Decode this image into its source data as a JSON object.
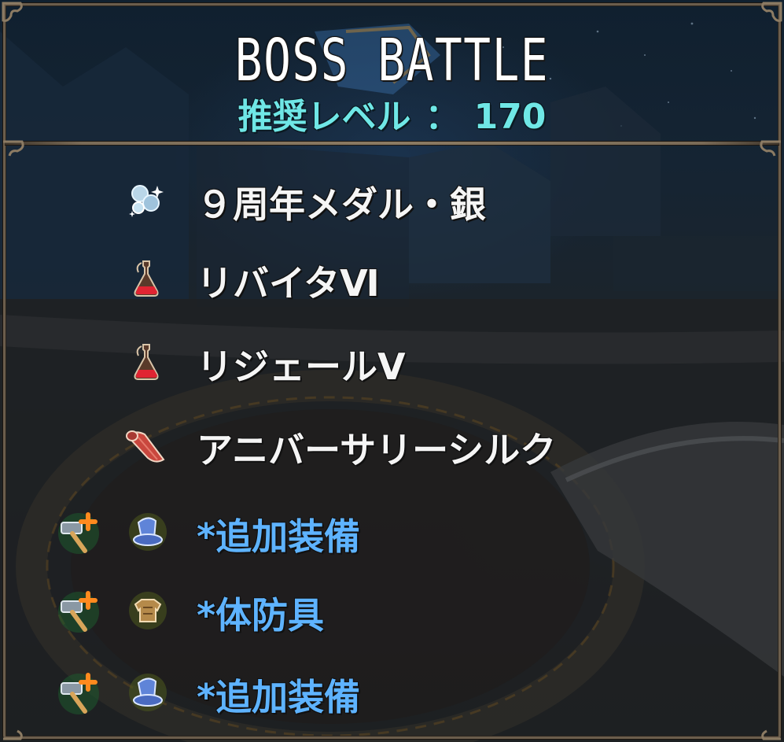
{
  "header": {
    "title": "BOSS BATTLE",
    "level_label": "推奨レベル",
    "level_separator": "：",
    "level_value": "170"
  },
  "rewards": [
    {
      "icon": "medal-icon",
      "label": "９周年メダル・銀",
      "color": "#f5f5f5"
    },
    {
      "icon": "potion-icon",
      "label": "リバイタⅥ",
      "color": "#f5f5f5"
    },
    {
      "icon": "potion-icon",
      "label": "リジェールⅤ",
      "color": "#f5f5f5"
    },
    {
      "icon": "silk-cloth-icon",
      "label": "アニバーサリーシルク",
      "color": "#f5f5f5"
    },
    {
      "badge_icon": "forge-plus-icon",
      "icon": "wizard-hat-icon",
      "label": "*追加装備",
      "color": "#5eb3ff"
    },
    {
      "badge_icon": "forge-plus-icon",
      "icon": "body-armor-icon",
      "label": "*体防具",
      "color": "#5eb3ff"
    },
    {
      "badge_icon": "forge-plus-icon",
      "icon": "wizard-hat-icon",
      "label": "*追加装備",
      "color": "#5eb3ff"
    }
  ],
  "colors": {
    "title": "#ffffff",
    "level": "#6fe7e6",
    "item_text": "#f5f5f5",
    "equipment_text": "#5eb3ff",
    "frame": "#6b5d4c"
  }
}
